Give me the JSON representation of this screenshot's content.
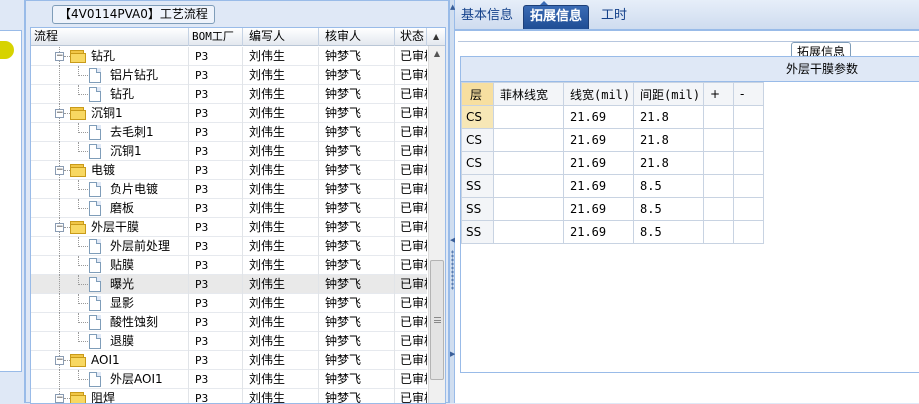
{
  "process_panel": {
    "title": "【4V0114PVA0】工艺流程",
    "columns": [
      "流程",
      "BOM工厂",
      "编写人",
      "核审人",
      "状态"
    ],
    "rows": [
      {
        "label": "钻孔",
        "type": "folder",
        "level": 1,
        "expanded": true,
        "bom": "P3",
        "author": "刘伟生",
        "reviewer": "钟梦飞",
        "status": "已审核"
      },
      {
        "label": "铝片钻孔",
        "type": "doc",
        "level": 2,
        "bom": "P3",
        "author": "刘伟生",
        "reviewer": "钟梦飞",
        "status": "已审核"
      },
      {
        "label": "钻孔",
        "type": "doc",
        "level": 2,
        "bom": "P3",
        "author": "刘伟生",
        "reviewer": "钟梦飞",
        "status": "已审核"
      },
      {
        "label": "沉铜1",
        "type": "folder",
        "level": 1,
        "expanded": true,
        "bom": "P3",
        "author": "刘伟生",
        "reviewer": "钟梦飞",
        "status": "已审核"
      },
      {
        "label": "去毛刺1",
        "type": "doc",
        "level": 2,
        "bom": "P3",
        "author": "刘伟生",
        "reviewer": "钟梦飞",
        "status": "已审核"
      },
      {
        "label": "沉铜1",
        "type": "doc",
        "level": 2,
        "bom": "P3",
        "author": "刘伟生",
        "reviewer": "钟梦飞",
        "status": "已审核"
      },
      {
        "label": "电镀",
        "type": "folder",
        "level": 1,
        "expanded": true,
        "bom": "P3",
        "author": "刘伟生",
        "reviewer": "钟梦飞",
        "status": "已审核"
      },
      {
        "label": "负片电镀",
        "type": "doc",
        "level": 2,
        "bom": "P3",
        "author": "刘伟生",
        "reviewer": "钟梦飞",
        "status": "已审核"
      },
      {
        "label": "磨板",
        "type": "doc",
        "level": 2,
        "bom": "P3",
        "author": "刘伟生",
        "reviewer": "钟梦飞",
        "status": "已审核"
      },
      {
        "label": "外层干膜",
        "type": "folder",
        "level": 1,
        "expanded": true,
        "bom": "P3",
        "author": "刘伟生",
        "reviewer": "钟梦飞",
        "status": "已审核"
      },
      {
        "label": "外层前处理",
        "type": "doc",
        "level": 2,
        "bom": "P3",
        "author": "刘伟生",
        "reviewer": "钟梦飞",
        "status": "已审核"
      },
      {
        "label": "贴膜",
        "type": "doc",
        "level": 2,
        "bom": "P3",
        "author": "刘伟生",
        "reviewer": "钟梦飞",
        "status": "已审核"
      },
      {
        "label": "曝光",
        "type": "doc",
        "level": 2,
        "selected": true,
        "bom": "P3",
        "author": "刘伟生",
        "reviewer": "钟梦飞",
        "status": "已审核"
      },
      {
        "label": "显影",
        "type": "doc",
        "level": 2,
        "bom": "P3",
        "author": "刘伟生",
        "reviewer": "钟梦飞",
        "status": "已审核"
      },
      {
        "label": "酸性蚀刻",
        "type": "doc",
        "level": 2,
        "bom": "P3",
        "author": "刘伟生",
        "reviewer": "钟梦飞",
        "status": "已审核"
      },
      {
        "label": "退膜",
        "type": "doc",
        "level": 2,
        "bom": "P3",
        "author": "刘伟生",
        "reviewer": "钟梦飞",
        "status": "已审核"
      },
      {
        "label": "AOI1",
        "type": "folder",
        "level": 1,
        "expanded": true,
        "bom": "P3",
        "author": "刘伟生",
        "reviewer": "钟梦飞",
        "status": "已审核"
      },
      {
        "label": "外层AOI1",
        "type": "doc",
        "level": 2,
        "bom": "P3",
        "author": "刘伟生",
        "reviewer": "钟梦飞",
        "status": "已审核"
      },
      {
        "label": "阻焊",
        "type": "folder",
        "level": 1,
        "expanded": true,
        "bom": "P3",
        "author": "刘伟生",
        "reviewer": "钟梦飞",
        "status": "已审核"
      }
    ]
  },
  "tabs": [
    {
      "label": "基本信息",
      "active": false
    },
    {
      "label": "拓展信息",
      "active": true
    },
    {
      "label": "工时",
      "active": false
    }
  ],
  "ext_section": {
    "legend": "拓展信息"
  },
  "params": {
    "title": "外层干膜参数",
    "columns": [
      "层",
      "菲林线宽",
      "线宽(mil)",
      "间距(mil)",
      "+",
      "-"
    ],
    "rows": [
      {
        "layer": "CS",
        "film_width": "",
        "line_width": "21.69",
        "spacing": "21.8"
      },
      {
        "layer": "CS",
        "film_width": "",
        "line_width": "21.69",
        "spacing": "21.8"
      },
      {
        "layer": "CS",
        "film_width": "",
        "line_width": "21.69",
        "spacing": "21.8"
      },
      {
        "layer": "SS",
        "film_width": "",
        "line_width": "21.69",
        "spacing": "8.5"
      },
      {
        "layer": "SS",
        "film_width": "",
        "line_width": "21.69",
        "spacing": "8.5"
      },
      {
        "layer": "SS",
        "film_width": "",
        "line_width": "21.69",
        "spacing": "8.5"
      }
    ]
  },
  "colors": {
    "accent": "#1f4d94",
    "panel_bg": "#dfe8f6",
    "border": "#99bbe8",
    "folder": "#f8d862"
  }
}
